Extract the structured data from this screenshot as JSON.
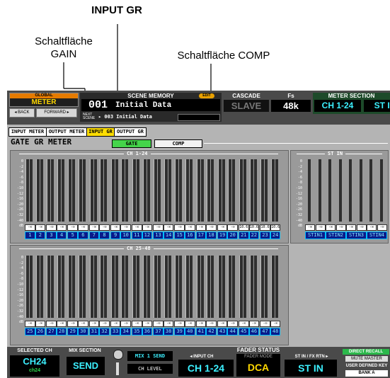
{
  "callouts": {
    "input_gr": "INPUT GR",
    "gain_line1": "Schaltfläche",
    "gain_line2": "GAIN",
    "comp": "Schaltfläche COMP"
  },
  "global": {
    "label": "GLOBAL",
    "value": "METER"
  },
  "nav": {
    "back": "◂ BACK",
    "forward": "FORWARD ▸"
  },
  "scene": {
    "label": "SCENE MEMORY",
    "edit": "EDIT",
    "number": "001",
    "title": "Initial Data",
    "next_label": "NEXT SCENE",
    "next": "▸ 003 Initial Data"
  },
  "cascade": {
    "label": "CASCADE",
    "value": "SLAVE"
  },
  "fs": {
    "label": "Fs",
    "value": "48k"
  },
  "meter_section": {
    "label": "METER SECTION",
    "left": "CH 1-24",
    "right": "ST IN"
  },
  "tabs": [
    {
      "label": "INPUT METER",
      "active": false
    },
    {
      "label": "OUTPUT METER",
      "active": false
    },
    {
      "label": "INPUT GR",
      "active": true
    },
    {
      "label": "OUTPUT GR",
      "active": false
    }
  ],
  "page": {
    "title": "GATE GR METER",
    "gate_button": "GATE",
    "comp_button": "COMP"
  },
  "sections": {
    "ch1": "CH 1-24",
    "ch2": "CH 25-48",
    "stin": "ST IN"
  },
  "scale": [
    "0",
    "-2",
    "-4",
    "-6",
    "-8",
    "-10",
    "-12",
    "-16",
    "-20",
    "-26",
    "-32",
    "-40",
    "dB"
  ],
  "ch1_values": [
    "-∞",
    "-∞",
    "-∞",
    "-∞",
    "-∞",
    "-∞",
    "-∞",
    "-∞",
    "-∞",
    "-∞",
    "-∞",
    "-∞",
    "-∞",
    "-∞",
    "-∞",
    "-∞",
    "-∞",
    "-∞",
    "-∞",
    "-∞",
    "10.6",
    "10.6",
    "10.6",
    "10.6"
  ],
  "ch1_labels": [
    "1",
    "2",
    "3",
    "4",
    "5",
    "6",
    "7",
    "8",
    "9",
    "10",
    "11",
    "12",
    "13",
    "14",
    "15",
    "16",
    "17",
    "18",
    "19",
    "20",
    "21",
    "22",
    "23",
    "24"
  ],
  "ch2_values": [
    "-∞",
    "-∞",
    "-∞",
    "-∞",
    "-∞",
    "-∞",
    "-∞",
    "-∞",
    "-∞",
    "-∞",
    "-∞",
    "-∞",
    "-∞",
    "-∞",
    "-∞",
    "-∞",
    "-∞",
    "-∞",
    "-∞",
    "-∞",
    "-∞",
    "-∞",
    "-∞",
    "-∞"
  ],
  "ch2_labels": [
    "25",
    "26",
    "27",
    "28",
    "29",
    "30",
    "31",
    "32",
    "33",
    "34",
    "35",
    "36",
    "37",
    "38",
    "39",
    "40",
    "41",
    "42",
    "43",
    "44",
    "45",
    "46",
    "47",
    "48"
  ],
  "stin_values": [
    "-∞",
    "-∞",
    "-∞",
    "-∞",
    "-∞",
    "-∞",
    "-∞",
    "-∞"
  ],
  "stin_labels": [
    "STIN1",
    "STIN2",
    "STIN3",
    "STIN4"
  ],
  "bottom": {
    "selected_ch_label": "SELECTED CH",
    "selected_ch": "CH24",
    "selected_ch_sub": "ch24",
    "mix_section_label": "MIX SECTION",
    "mix_section": "SEND",
    "mix_send": "MIX 1 SEND",
    "ch_level": "CH LEVEL",
    "fader_status_label": "FADER STATUS",
    "input_ch_label": "◂ INPUT CH",
    "input_ch": "CH 1-24",
    "fader_mode_label": "FADER MODE",
    "fader_mode": "DCA",
    "stin_fx_label": "ST IN / FX RTN ▸",
    "stin_fx": "ST IN",
    "direct_recall": "DIRECT RECALL",
    "mute_master": "MUTE MASTER",
    "user_defined": "USER DEFINED KEY",
    "bank": "BANK A"
  }
}
